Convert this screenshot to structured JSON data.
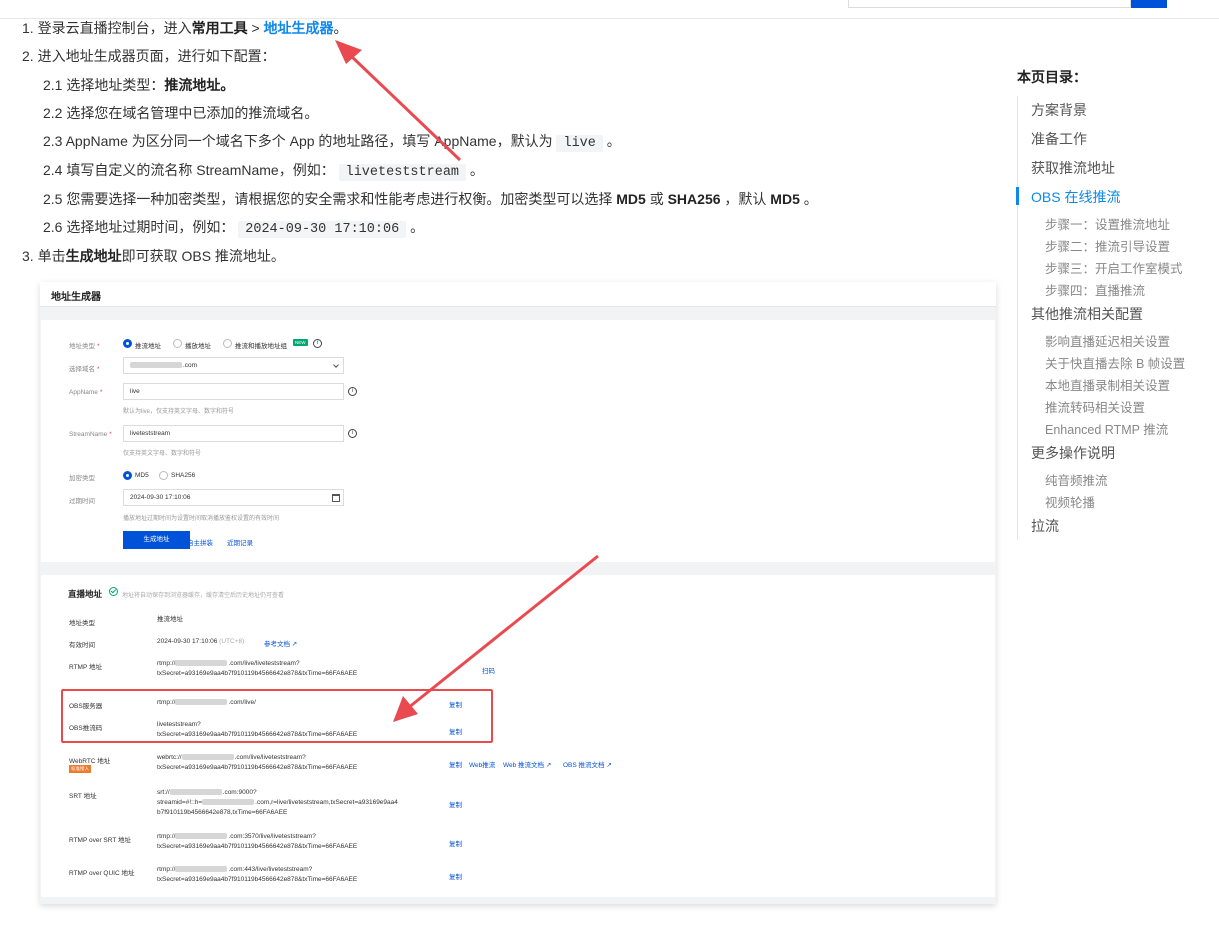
{
  "article": {
    "step1": {
      "num": "1.",
      "pre": "登录云直播控制台，进入",
      "bold": "常用工具",
      "sep": " > ",
      "link": "地址生成器",
      "post": "。"
    },
    "step2": {
      "num": "2.",
      "text": "进入地址生成器页面，进行如下配置："
    },
    "sub1": {
      "num": "2.1",
      "pre": "选择地址类型：",
      "bold": "推流地址。"
    },
    "sub2": {
      "num": "2.2",
      "text": "选择您在域名管理中已添加的推流域名。"
    },
    "sub3": {
      "num": "2.3",
      "pre": "AppName 为区分同一个域名下多个 App 的地址路径，填写 AppName，默认为",
      "code": "live",
      "post": "。"
    },
    "sub4": {
      "num": "2.4",
      "pre": "填写自定义的流名称 StreamName，例如：",
      "code": "liveteststream",
      "post": "。"
    },
    "sub5": {
      "num": "2.5",
      "pre": "您需要选择一种加密类型，请根据您的安全需求和性能考虑进行权衡。加密类型可以选择",
      "b1": "MD5",
      "or": "或",
      "b2": "SHA256",
      "mid": "，默认",
      "b3": "MD5",
      "post": "。"
    },
    "sub6": {
      "num": "2.6",
      "pre": "选择地址过期时间，例如：",
      "code": "2024-09-30 17:10:06",
      "post": "。"
    },
    "step3": {
      "num": "3.",
      "pre": "单击",
      "bold": "生成地址",
      "post": "即可获取 OBS 推流地址。"
    }
  },
  "screenshot": {
    "header": "地址生成器",
    "form": {
      "addr_type_label": "地址类型",
      "addr_type_options": [
        "推流地址",
        "播放地址",
        "推流和播放地址组"
      ],
      "new_tag": "NEW",
      "domain_label": "选择域名",
      "domain_value": ".com",
      "appname_label": "AppName",
      "appname_value": "live",
      "appname_hint": "默认为live，仅支持英文字母、数字和符号",
      "stream_label": "StreamName",
      "stream_value": "liveteststream",
      "stream_hint": "仅支持英文字母、数字和符号",
      "enc_label": "加密类型",
      "enc_options": [
        "MD5",
        "SHA256"
      ],
      "expire_label": "过期时间",
      "expire_value": "2024-09-30 17:10:06",
      "expire_hint": "播放地址过期时间为设置时间取消播放鉴权设置的有效时间",
      "generate_btn": "生成地址",
      "link_tutorial": "自主拼装",
      "link_history": "近期记录"
    },
    "result": {
      "title": "直播地址",
      "note": "地址将自动保存到浏览器缓存，缓存清空后历史地址仍可查看",
      "rows": {
        "type_label": "地址类型",
        "type_value": "推流地址",
        "valid_label": "有效时间",
        "valid_value": "2024-09-30 17:10:06",
        "valid_tz": "(UTC+8)",
        "valid_link": "参考文档",
        "rtmp_label": "RTMP 地址",
        "rtmp_l1": "rtmp://",
        "rtmp_l1b": ".com/live/liveteststream?",
        "rtmp_l2": "txSecret=a93169e9aa4b7f910119b4566642e878&txTime=66FA6AEE",
        "rtmp_link": "扫码",
        "obs_server_label": "OBS服务器",
        "obs_server_value": "rtmp://",
        "obs_server_value_b": ".com/live/",
        "obs_server_link": "复制",
        "obs_key_label": "OBS推流码",
        "obs_key_l1": "liveteststream?",
        "obs_key_l2": "txSecret=a93169e9aa4b7f910119b4566642e878&txTime=66FA6AEE",
        "obs_key_link": "复制",
        "webrtc_label": "WebRTC 地址",
        "webrtc_badge": "标准接入",
        "webrtc_l1": "webrtc://",
        "webrtc_l1b": ".com/live/liveteststream?",
        "webrtc_l2": "txSecret=a93169e9aa4b7f910119b4566642e878&txTime=66FA6AEE",
        "webrtc_links": [
          "复制",
          "Web推流",
          "Web 推流文档",
          "OBS 推流文档"
        ],
        "srt_label": "SRT 地址",
        "srt_l1": "srt://",
        "srt_l1b": ".com:9000?",
        "srt_l2": "streamid=#!::h=",
        "srt_l2b": ".com,r=live/liveteststream,txSecret=a93169e9aa4",
        "srt_l3": "b7f910119b4566642e878,txTime=66FA6AEE",
        "srt_link": "复制",
        "rtmpsrt_label": "RTMP over SRT 地址",
        "rtmpsrt_l1": "rtmp://",
        "rtmpsrt_l1b": ".com:3570/live/liveteststream?",
        "rtmpsrt_l2": "txSecret=a93169e9aa4b7f910119b4566642e878&txTime=66FA6AEE",
        "rtmpsrt_link": "复制",
        "rtmpquic_label": "RTMP over QUIC 地址",
        "rtmpquic_l1": "rtmp://",
        "rtmpquic_l1b": ".com:443/live/liveteststream?",
        "rtmpquic_l2": "txSecret=a93169e9aa4b7f910119b4566642e878&txTime=66FA6AEE",
        "rtmpquic_link": "复制"
      }
    }
  },
  "toc": {
    "title": "本页目录：",
    "items": [
      "方案背景",
      "准备工作",
      "获取推流地址",
      "OBS 在线推流",
      "步骤一：设置推流地址",
      "步骤二：推流引导设置",
      "步骤三：开启工作室模式",
      "步骤四：直播推流",
      "其他推流相关配置",
      "影响直播延迟相关设置",
      "关于快直播去除 B 帧设置",
      "本地直播录制相关设置",
      "推流转码相关设置",
      "Enhanced RTMP 推流",
      "更多操作说明",
      "纯音频推流",
      "视频轮播",
      "拉流"
    ]
  },
  "colors": {
    "accent": "#0e88eb",
    "primary_button": "#0052d9",
    "annotation": "#e84a4f"
  }
}
